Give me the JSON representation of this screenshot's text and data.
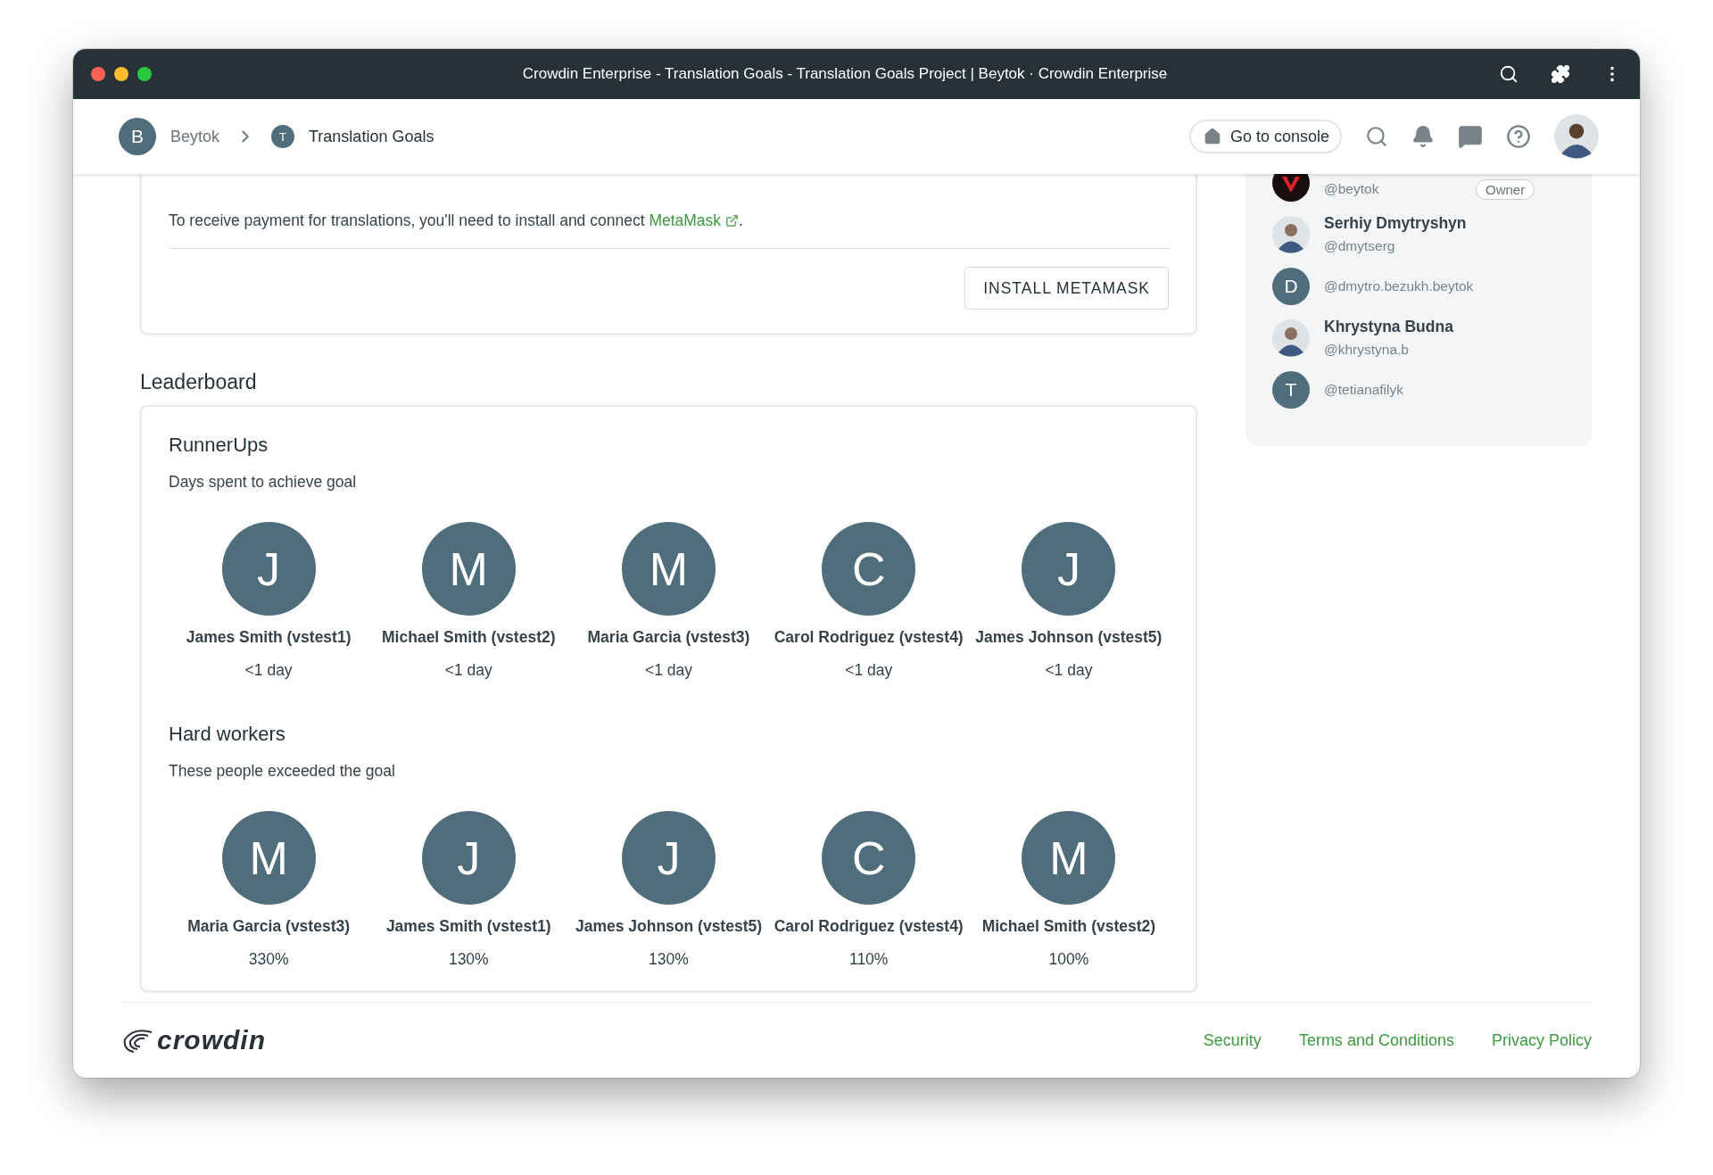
{
  "window": {
    "title": "Crowdin Enterprise - Translation Goals - Translation Goals Project | Beytok · Crowdin Enterprise"
  },
  "breadcrumb": [
    {
      "initial": "B",
      "label": "Beytok",
      "current": false
    },
    {
      "initial": "T",
      "label": "Translation Goals",
      "current": true
    }
  ],
  "header": {
    "console_button": "Go to console"
  },
  "notice": {
    "text": "To receive payment for translations, you'll need to install and connect ",
    "link": "MetaMask",
    "after": ".",
    "button": "INSTALL METAMASK"
  },
  "members": [
    {
      "kind": "logo",
      "handle": "@beytok",
      "badge": "Owner"
    },
    {
      "kind": "photo",
      "name": "Serhiy Dmytryshyn",
      "handle": "@dmytserg"
    },
    {
      "kind": "initial",
      "initial": "D",
      "handle": "@dmytro.bezukh.beytok"
    },
    {
      "kind": "photo",
      "name": "Khrystyna Budna",
      "handle": "@khrystyna.b"
    },
    {
      "kind": "initial",
      "initial": "T",
      "handle": "@tetianafilyk"
    }
  ],
  "leaderboard": {
    "title": "Leaderboard",
    "sections": [
      {
        "title": "RunnerUps",
        "subtitle": "Days spent to achieve goal",
        "people": [
          {
            "initial": "J",
            "name": "James Smith (vstest1)",
            "value": "<1 day"
          },
          {
            "initial": "M",
            "name": "Michael Smith (vstest2)",
            "value": "<1 day"
          },
          {
            "initial": "M",
            "name": "Maria Garcia (vstest3)",
            "value": "<1 day"
          },
          {
            "initial": "C",
            "name": "Carol Rodriguez (vstest4)",
            "value": "<1 day"
          },
          {
            "initial": "J",
            "name": "James Johnson (vstest5)",
            "value": "<1 day"
          }
        ]
      },
      {
        "title": "Hard workers",
        "subtitle": "These people exceeded the goal",
        "people": [
          {
            "initial": "M",
            "name": "Maria Garcia (vstest3)",
            "value": "330%"
          },
          {
            "initial": "J",
            "name": "James Smith (vstest1)",
            "value": "130%"
          },
          {
            "initial": "J",
            "name": "James Johnson (vstest5)",
            "value": "130%"
          },
          {
            "initial": "C",
            "name": "Carol Rodriguez (vstest4)",
            "value": "110%"
          },
          {
            "initial": "M",
            "name": "Michael Smith (vstest2)",
            "value": "100%"
          }
        ]
      }
    ]
  },
  "footer": {
    "logo_text": "crowdin",
    "links": [
      "Security",
      "Terms and Conditions",
      "Privacy Policy"
    ]
  }
}
